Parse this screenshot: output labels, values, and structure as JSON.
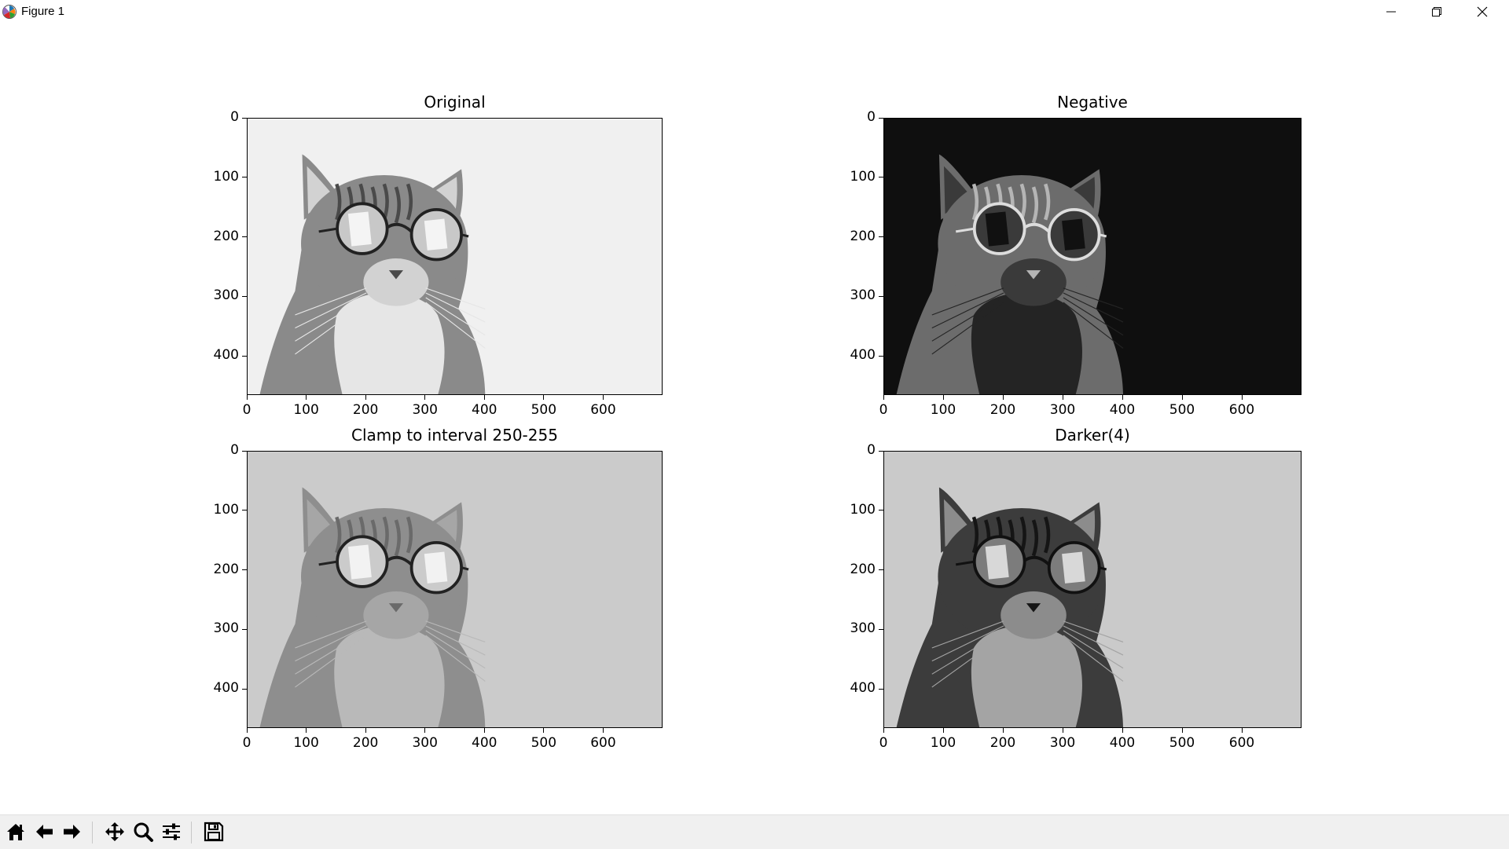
{
  "window": {
    "title": "Figure 1"
  },
  "toolbar": {
    "buttons": [
      {
        "name": "home-button",
        "icon": "home-icon"
      },
      {
        "name": "back-button",
        "icon": "arrow-left-icon"
      },
      {
        "name": "forward-button",
        "icon": "arrow-right-icon"
      },
      {
        "name": "pan-button",
        "icon": "move-icon"
      },
      {
        "name": "zoom-button",
        "icon": "magnifier-icon"
      },
      {
        "name": "configure-subplots-button",
        "icon": "sliders-icon"
      },
      {
        "name": "save-button",
        "icon": "floppy-disk-icon"
      }
    ]
  },
  "subplots": [
    {
      "title": "Original",
      "background": "#f0f0f0",
      "cat_tone": "normal"
    },
    {
      "title": "Negative",
      "background": "#0f0f0f",
      "cat_tone": "inverted"
    },
    {
      "title": "Clamp to interval 250-255",
      "background": "#cbcbcb",
      "cat_tone": "posterized"
    },
    {
      "title": "Darker(4)",
      "background": "#cacaca",
      "cat_tone": "dark"
    }
  ],
  "axes": {
    "x_ticks": [
      "0",
      "100",
      "200",
      "300",
      "400",
      "500",
      "600"
    ],
    "y_ticks": [
      "0",
      "100",
      "200",
      "300",
      "400"
    ],
    "xlim": [
      0,
      700
    ],
    "ylim": [
      466,
      0
    ]
  }
}
